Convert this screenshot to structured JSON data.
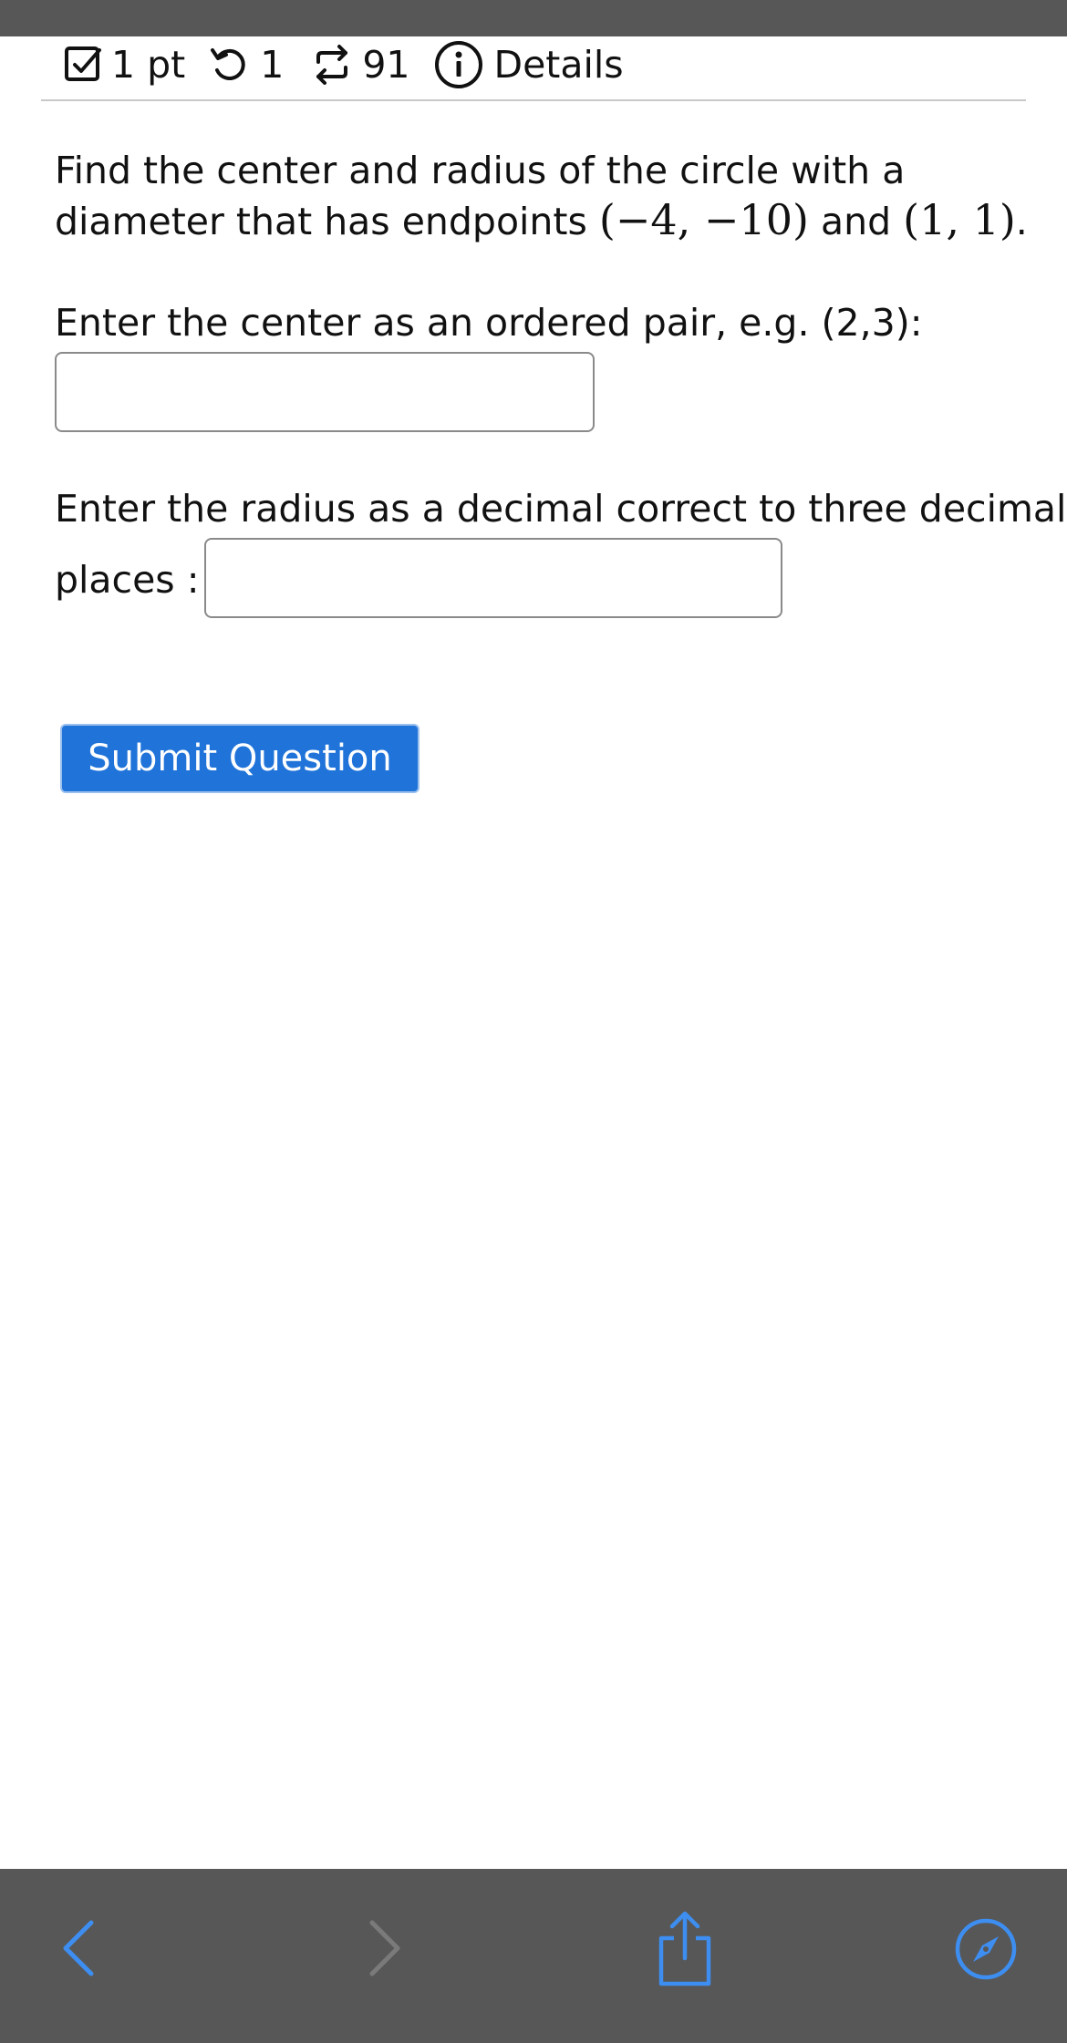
{
  "meta": {
    "points": "1 pt",
    "retries": "1",
    "attempts": "91",
    "details": "Details"
  },
  "question": {
    "text_before": "Find the center and radius of the circle with a diameter that has endpoints ",
    "endpoint_a": "(−4, −10)",
    "text_and": " and ",
    "endpoint_b": "(1, 1)",
    "text_end": "."
  },
  "center_prompt": "Enter the center as an ordered pair, e.g. (2,3):",
  "center_input": {
    "value": "",
    "placeholder": ""
  },
  "radius_prompt_line1": "Enter the radius as a decimal correct to three decimal",
  "radius_prompt_line2": "places :",
  "radius_input": {
    "value": "",
    "placeholder": ""
  },
  "submit_label": "Submit Question",
  "colors": {
    "accent": "#1f73d9",
    "browser_bar": "#575757",
    "nav_icon_active": "#3d8ef0",
    "nav_icon_disabled": "#7a7a7a"
  },
  "browser_nav": {
    "back_icon": "chevron-left-icon",
    "forward_icon": "chevron-right-icon",
    "share_icon": "share-icon",
    "safari_icon": "compass-icon"
  }
}
